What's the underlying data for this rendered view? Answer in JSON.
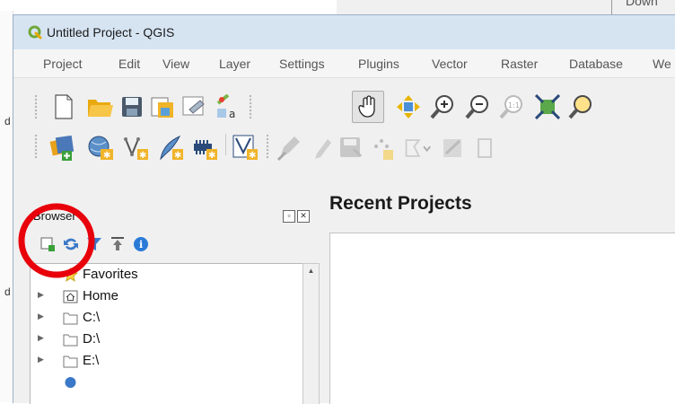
{
  "background": {
    "right_text": "Down",
    "left_letters": [
      "d",
      "d"
    ]
  },
  "window": {
    "title": "Untitled Project - QGIS"
  },
  "menubar": {
    "items": [
      "Project",
      "Edit",
      "View",
      "Layer",
      "Settings",
      "Plugins",
      "Vector",
      "Raster",
      "Database",
      "We"
    ]
  },
  "toolbar_file": {
    "icons": [
      "new-project-icon",
      "open-project-icon",
      "save-project-icon",
      "save-as-icon",
      "print-composer-icon",
      "style-manager-icon",
      "pan-icon",
      "pan-to-selection-icon",
      "zoom-in-icon",
      "zoom-out-icon",
      "zoom-native-icon",
      "zoom-full-icon",
      "zoom-to-layer-icon"
    ]
  },
  "toolbar_layers": {
    "icons": [
      "data-source-manager-icon",
      "add-wms-layer-icon",
      "add-vector-layer-icon",
      "new-shapefile-icon",
      "add-raster-layer-icon",
      "digitize-icon",
      "edit-pencil-icon",
      "save-edits-icon",
      "add-feature-icon",
      "node-tool-icon",
      "delete-selected-icon"
    ]
  },
  "browser": {
    "title": "Browser",
    "tools": [
      "add-selected-icon",
      "refresh-icon",
      "filter-icon",
      "collapse-all-icon",
      "info-icon"
    ],
    "items": [
      {
        "label": "Favorites",
        "icon": "star-icon",
        "expandable": false
      },
      {
        "label": "Home",
        "icon": "home-folder-icon",
        "expandable": true
      },
      {
        "label": "C:\\",
        "icon": "folder-icon",
        "expandable": true
      },
      {
        "label": "D:\\",
        "icon": "folder-icon",
        "expandable": true
      },
      {
        "label": "E:\\",
        "icon": "folder-icon",
        "expandable": true
      }
    ]
  },
  "recent": {
    "title": "Recent Projects"
  },
  "colors": {
    "highlight": "#e8000b",
    "titlebar": "#d6e4f2",
    "qgis_green": "#6fa83a"
  }
}
